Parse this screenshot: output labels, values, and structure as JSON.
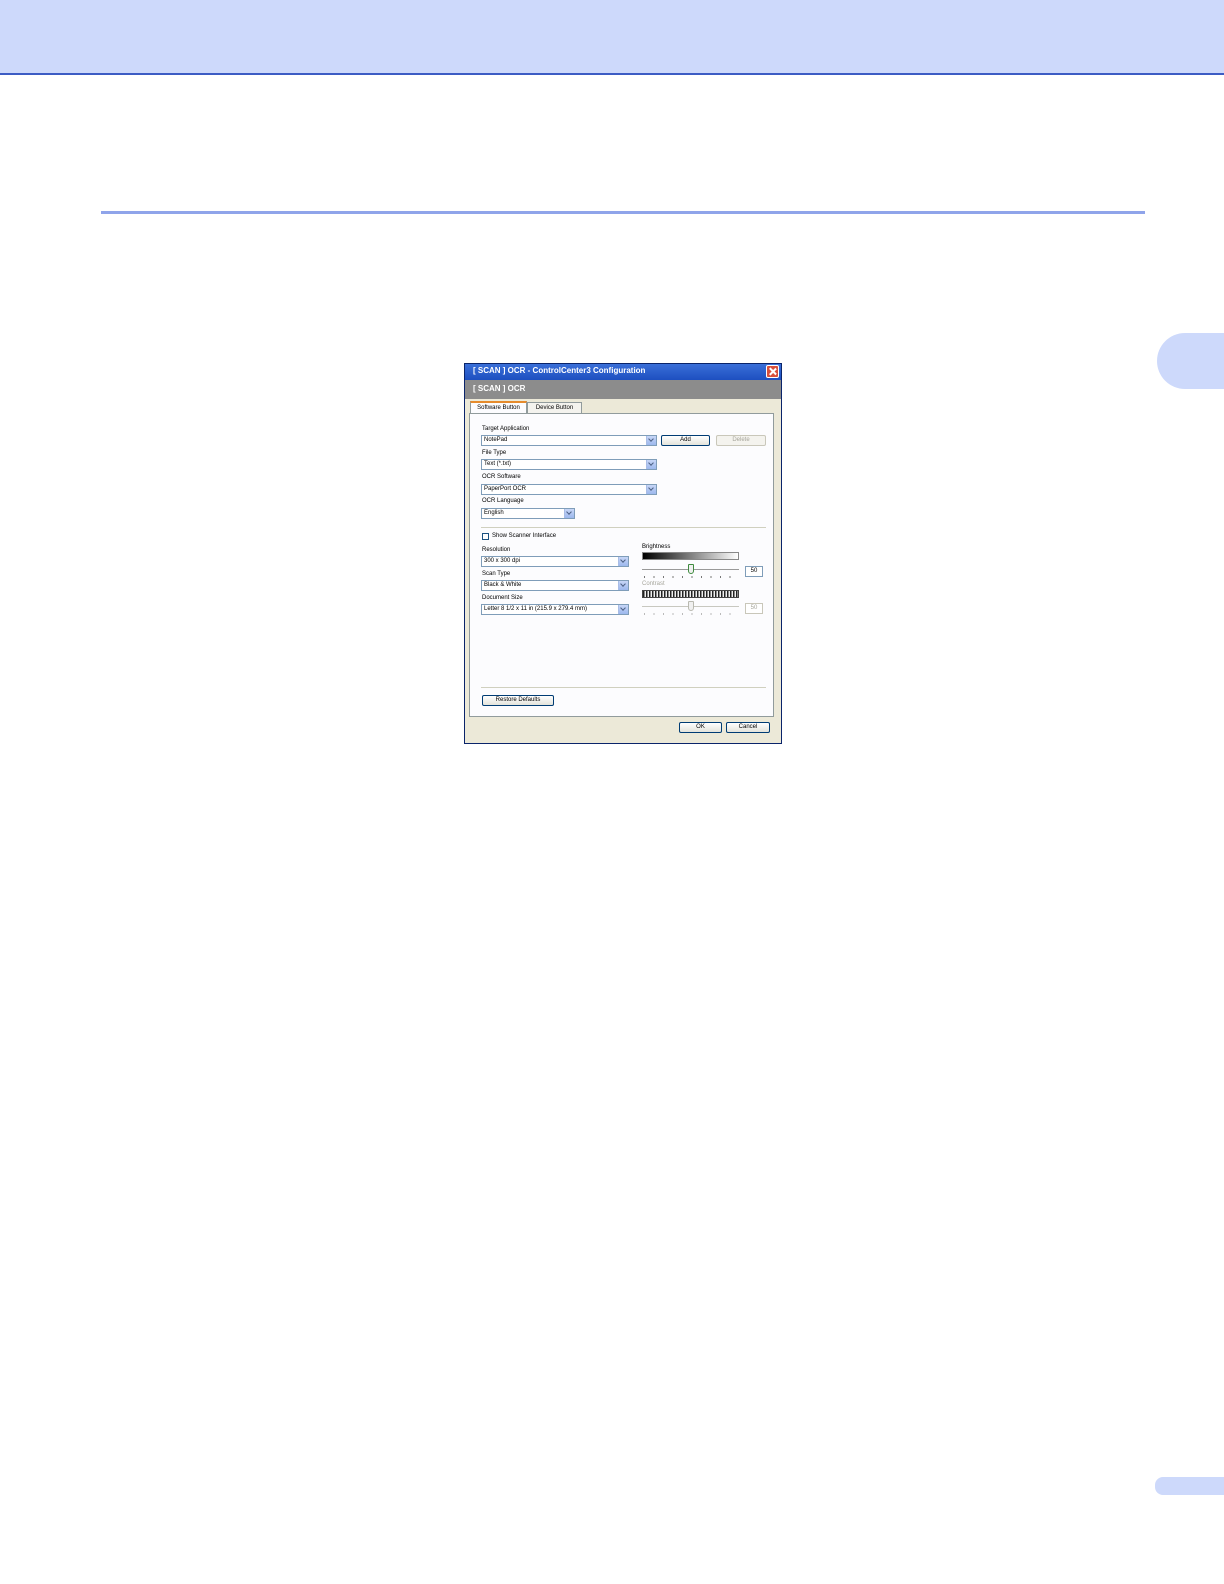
{
  "dialog": {
    "title": "[ SCAN ] OCR - ControlCenter3 Configuration",
    "header": "[ SCAN ] OCR",
    "tabs": [
      {
        "label": "Software Button",
        "active": true
      },
      {
        "label": "Device Button",
        "active": false
      }
    ],
    "target_application": {
      "label": "Target Application",
      "value": "NotePad"
    },
    "add_label": "Add",
    "delete_label": "Delete",
    "file_type": {
      "label": "File Type",
      "value": "Text (*.txt)"
    },
    "ocr_software": {
      "label": "OCR Software",
      "value": "PaperPort OCR"
    },
    "ocr_language": {
      "label": "OCR Language",
      "value": "English"
    },
    "show_scanner_interface": {
      "label": "Show Scanner Interface",
      "checked": false
    },
    "resolution": {
      "label": "Resolution",
      "value": "300 x 300 dpi"
    },
    "scan_type": {
      "label": "Scan Type",
      "value": "Black & White"
    },
    "document_size": {
      "label": "Document Size",
      "value": "Letter 8 1/2 x 11 in (215.9 x 279.4 mm)"
    },
    "brightness": {
      "label": "Brightness",
      "value": "50",
      "level": 0.5,
      "enabled": true
    },
    "contrast": {
      "label": "Contrast",
      "value": "50",
      "level": 0.5,
      "enabled": false
    },
    "restore_defaults_label": "Restore Defaults",
    "ok_label": "OK",
    "cancel_label": "Cancel"
  },
  "colors": {
    "page_band": "#cdd9fb",
    "rule": "#8fa4ea",
    "titlebar": "#1d4fc0",
    "header_band": "#8c8c8c",
    "dialog_body": "#ece9d8"
  }
}
